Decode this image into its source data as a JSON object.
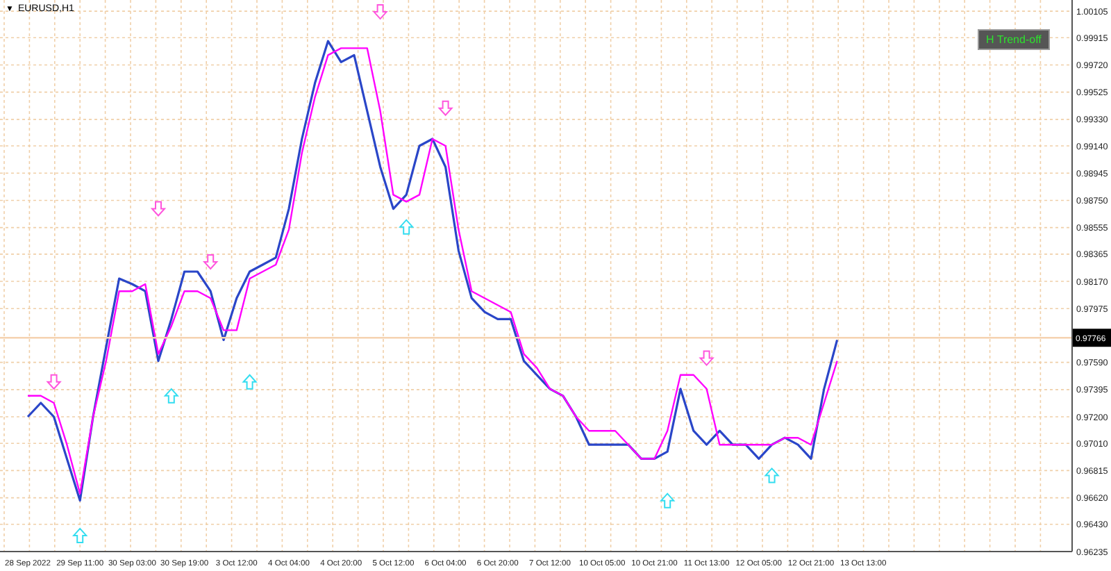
{
  "chart_title": {
    "arrow": "▼",
    "symbol": "EURUSD,H1"
  },
  "toggle_button": {
    "label": "H Trend-off"
  },
  "chart_data": {
    "type": "line",
    "categories": [
      "28 Sep 2022",
      null,
      null,
      null,
      "29 Sep 11:00",
      null,
      null,
      null,
      "30 Sep 03:00",
      null,
      null,
      null,
      "30 Sep 19:00",
      null,
      null,
      null,
      "3 Oct 12:00",
      null,
      null,
      null,
      "4 Oct 04:00",
      null,
      null,
      null,
      "4 Oct 20:00",
      null,
      null,
      null,
      "5 Oct 12:00",
      null,
      null,
      null,
      "6 Oct 04:00",
      null,
      null,
      null,
      "6 Oct 20:00",
      null,
      null,
      null,
      "7 Oct 12:00",
      null,
      null,
      null,
      "10 Oct 05:00",
      null,
      null,
      null,
      "10 Oct 21:00",
      null,
      null,
      null,
      "11 Oct 13:00",
      null,
      null,
      null,
      "12 Oct 05:00",
      null,
      null,
      null,
      "12 Oct 21:00",
      null,
      null,
      null,
      "13 Oct 13:00"
    ],
    "series": [
      {
        "type": "line",
        "color": "#2a46c8",
        "values": [
          0.972,
          0.973,
          0.972,
          0.969,
          0.966,
          0.972,
          0.977,
          0.9819,
          0.9815,
          0.981,
          0.976,
          0.979,
          0.9824,
          0.9824,
          0.981,
          0.9775,
          0.9805,
          0.9824,
          0.9829,
          0.9834,
          0.9869,
          0.9919,
          0.9959,
          0.9989,
          0.9974,
          0.9979,
          0.9939,
          0.9899,
          0.9869,
          0.9879,
          0.9914,
          0.9919,
          0.9899,
          0.9839,
          0.9805,
          0.9795,
          0.979,
          0.979,
          0.976,
          0.975,
          0.974,
          0.9735,
          0.972,
          0.97,
          0.97,
          0.97,
          0.97,
          0.969,
          0.969,
          0.9695,
          0.974,
          0.971,
          0.97,
          0.971,
          0.97,
          0.97,
          0.969,
          0.97,
          0.9705,
          0.97,
          0.969,
          0.974,
          0.9775,
          null,
          null
        ]
      },
      {
        "type": "line",
        "color": "#ff00ff",
        "values": [
          0.9735,
          0.9735,
          0.973,
          0.97,
          0.9665,
          0.972,
          0.976,
          0.981,
          0.981,
          0.9815,
          0.9765,
          0.9785,
          0.981,
          0.981,
          0.9805,
          0.9782,
          0.9782,
          0.9819,
          0.9824,
          0.9829,
          0.9854,
          0.9909,
          0.9949,
          0.9979,
          0.9984,
          0.9984,
          0.9984,
          0.9939,
          0.9879,
          0.9874,
          0.9879,
          0.9919,
          0.9914,
          0.9854,
          0.981,
          0.9805,
          0.98,
          0.9795,
          0.9765,
          0.9755,
          0.974,
          0.9735,
          0.972,
          0.971,
          0.971,
          0.971,
          0.97,
          0.969,
          0.969,
          0.971,
          0.975,
          0.975,
          0.974,
          0.97,
          0.97,
          0.97,
          0.97,
          0.97,
          0.9705,
          0.9705,
          0.97,
          0.973,
          0.976,
          null,
          null
        ]
      },
      {
        "type": "scatter",
        "color": "#ff55dd",
        "values": [
          null,
          null,
          0.9745,
          null,
          null,
          null,
          null,
          null,
          null,
          null,
          0.9869,
          null,
          null,
          null,
          0.9831,
          null,
          null,
          null,
          null,
          null,
          null,
          null,
          null,
          null,
          null,
          null,
          null,
          1.001,
          null,
          null,
          null,
          null,
          0.9941,
          null,
          null,
          null,
          null,
          null,
          null,
          null,
          null,
          null,
          null,
          null,
          null,
          null,
          null,
          null,
          null,
          null,
          null,
          null,
          0.9762,
          null,
          null,
          null,
          null,
          null,
          null,
          null,
          null,
          null,
          null,
          null,
          null
        ]
      },
      {
        "type": "scatter",
        "color": "#33ddf0",
        "values": [
          null,
          null,
          null,
          null,
          0.9635,
          null,
          null,
          null,
          null,
          null,
          null,
          0.9735,
          null,
          null,
          null,
          null,
          null,
          0.9745,
          null,
          null,
          null,
          null,
          null,
          null,
          null,
          null,
          null,
          null,
          null,
          0.9856,
          null,
          null,
          null,
          null,
          null,
          null,
          null,
          null,
          null,
          null,
          null,
          null,
          null,
          null,
          null,
          null,
          null,
          null,
          null,
          0.966,
          null,
          null,
          null,
          null,
          null,
          null,
          null,
          0.9678,
          null,
          null,
          null,
          null,
          null,
          null,
          null
        ]
      }
    ],
    "ylim": [
      0.96235,
      1.00185
    ],
    "yticks": [
      {
        "value": 1.00105,
        "label": "1.00105"
      },
      {
        "value": 0.99915,
        "label": "0.99915"
      },
      {
        "value": 0.9972,
        "label": "0.99720"
      },
      {
        "value": 0.99525,
        "label": "0.99525"
      },
      {
        "value": 0.9933,
        "label": "0.99330"
      },
      {
        "value": 0.9914,
        "label": "0.99140"
      },
      {
        "value": 0.98945,
        "label": "0.98945"
      },
      {
        "value": 0.9875,
        "label": "0.98750"
      },
      {
        "value": 0.98555,
        "label": "0.98555"
      },
      {
        "value": 0.98365,
        "label": "0.98365"
      },
      {
        "value": 0.9817,
        "label": "0.98170"
      },
      {
        "value": 0.97975,
        "label": "0.97975"
      },
      {
        "value": 0.9759,
        "label": "0.97590"
      },
      {
        "value": 0.97395,
        "label": "0.97395"
      },
      {
        "value": 0.972,
        "label": "0.97200"
      },
      {
        "value": 0.9701,
        "label": "0.97010"
      },
      {
        "value": 0.96815,
        "label": "0.96815"
      },
      {
        "value": 0.9662,
        "label": "0.96620"
      },
      {
        "value": 0.9643,
        "label": "0.96430"
      },
      {
        "value": 0.96235,
        "label": "0.96235"
      }
    ],
    "grid": true,
    "ref_lines": [
      {
        "axis": "y",
        "value": 0.97766,
        "label": "0.97766"
      }
    ]
  }
}
